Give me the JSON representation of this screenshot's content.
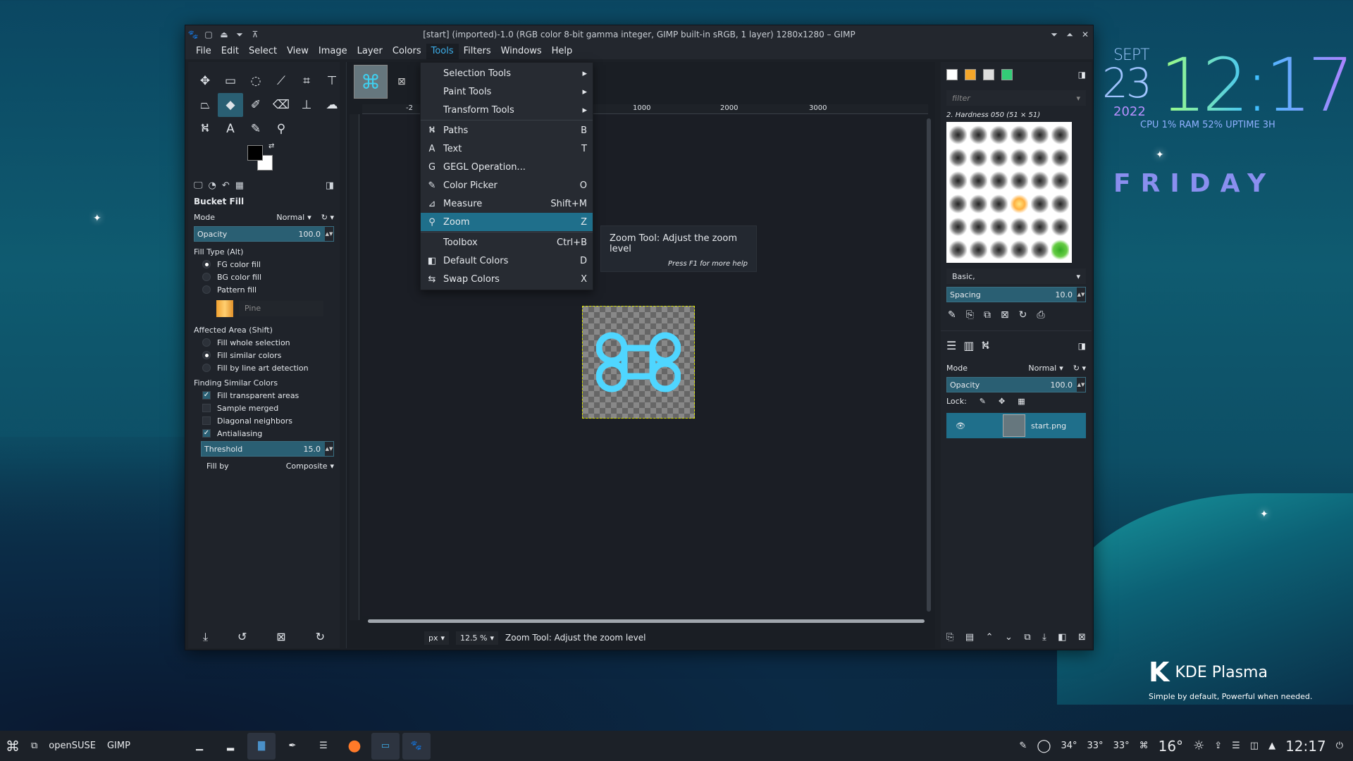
{
  "window": {
    "title": "[start] (imported)-1.0 (RGB color 8-bit gamma integer, GIMP built-in sRGB, 1 layer) 1280x1280 – GIMP"
  },
  "menubar": [
    "File",
    "Edit",
    "Select",
    "View",
    "Image",
    "Layer",
    "Colors",
    "Tools",
    "Filters",
    "Windows",
    "Help"
  ],
  "active_menu": "Tools",
  "tool_options": {
    "title": "Bucket Fill",
    "mode_label": "Mode",
    "mode_value": "Normal",
    "opacity_label": "Opacity",
    "opacity_value": "100.0",
    "opacity_fraction": 1.0,
    "fill_type_label": "Fill Type  (Alt)",
    "fill_types": [
      "FG color fill",
      "BG color fill",
      "Pattern fill"
    ],
    "fill_type_selected": 0,
    "pattern_name": "Pine",
    "affected_label": "Affected Area  (Shift)",
    "affected": [
      "Fill whole selection",
      "Fill similar colors",
      "Fill by line art detection"
    ],
    "affected_selected": 1,
    "finding_label": "Finding Similar Colors",
    "checks": [
      {
        "label": "Fill transparent areas",
        "checked": true
      },
      {
        "label": "Sample merged",
        "checked": false
      },
      {
        "label": "Diagonal neighbors",
        "checked": false
      },
      {
        "label": "Antialiasing",
        "checked": true
      }
    ],
    "threshold_label": "Threshold",
    "threshold_value": "15.0",
    "fillby_label": "Fill by",
    "fillby_value": "Composite"
  },
  "tools_menu": [
    {
      "icon": "",
      "label": "Selection Tools",
      "shortcut": "▸"
    },
    {
      "icon": "",
      "label": "Paint Tools",
      "shortcut": "▸"
    },
    {
      "icon": "",
      "label": "Transform Tools",
      "shortcut": "▸"
    },
    {
      "icon": "⛕",
      "label": "Paths",
      "shortcut": "B"
    },
    {
      "icon": "A",
      "label": "Text",
      "shortcut": "T"
    },
    {
      "icon": "G",
      "label": "GEGL Operation...",
      "shortcut": ""
    },
    {
      "icon": "✎",
      "label": "Color Picker",
      "shortcut": "O"
    },
    {
      "icon": "⊿",
      "label": "Measure",
      "shortcut": "Shift+M"
    },
    {
      "icon": "⚲",
      "label": "Zoom",
      "shortcut": "Z"
    },
    {
      "icon": "",
      "label": "Toolbox",
      "shortcut": "Ctrl+B"
    },
    {
      "icon": "◧",
      "label": "Default Colors",
      "shortcut": "D"
    },
    {
      "icon": "⇆",
      "label": "Swap Colors",
      "shortcut": "X"
    }
  ],
  "tooltip": {
    "title": "Zoom Tool: Adjust the zoom level",
    "help": "Press F1 for more help"
  },
  "ruler": {
    "h": [
      "-2",
      "1000",
      "2000",
      "3000"
    ]
  },
  "status": {
    "unit": "px",
    "zoom": "12.5 %",
    "message": "Zoom Tool: Adjust the zoom level"
  },
  "brushes": {
    "filter_placeholder": "filter",
    "current": "2. Hardness 050 (51 × 51)",
    "preset": "Basic,",
    "spacing_label": "Spacing",
    "spacing_value": "10.0"
  },
  "layers": {
    "mode_label": "Mode",
    "mode_value": "Normal",
    "opacity_label": "Opacity",
    "opacity_value": "100.0",
    "lock_label": "Lock:",
    "items": [
      {
        "name": "start.png",
        "visible": true
      }
    ]
  },
  "clock": {
    "month": "SEPT",
    "day": "23",
    "year": "2022",
    "time": "12:17",
    "stats": "CPU 1% RAM 52% UPTIME 3H",
    "weekday": "FRIDAY"
  },
  "kde": {
    "name": "KDE Plasma",
    "tagline": "Simple by default, Powerful when needed."
  },
  "panel": {
    "label1": "openSUSE",
    "label2": "GIMP",
    "temps": [
      "34°",
      "33°",
      "33°"
    ],
    "weather": "16°",
    "time": "12:17"
  },
  "colors": {
    "accent": "#1f6f8b",
    "highlight": "#3daee9",
    "fg": "#000000",
    "bg": "#ffffff"
  }
}
